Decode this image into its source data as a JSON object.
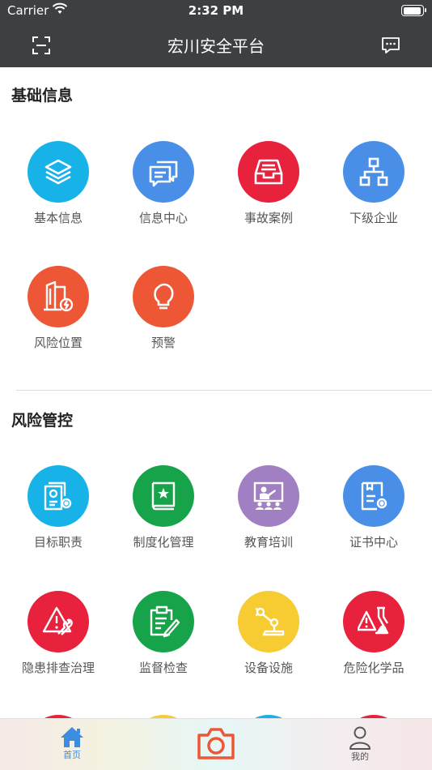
{
  "status_bar": {
    "carrier": "Carrier",
    "time": "2:32 PM"
  },
  "nav": {
    "title": "宏川安全平台"
  },
  "sections": [
    {
      "title": "基础信息",
      "items": [
        {
          "label": "基本信息",
          "icon": "layers-icon",
          "color": "#17b3e8"
        },
        {
          "label": "信息中心",
          "icon": "chat-bubbles-icon",
          "color": "#4a8fe7"
        },
        {
          "label": "事故案例",
          "icon": "inbox-tray-icon",
          "color": "#e8213c"
        },
        {
          "label": "下级企业",
          "icon": "org-chart-icon",
          "color": "#4a8fe7"
        },
        {
          "label": "风险位置",
          "icon": "building-alert-icon",
          "color": "#ee5736"
        },
        {
          "label": "预警",
          "icon": "lightbulb-icon",
          "color": "#ee5736"
        }
      ]
    },
    {
      "title": "风险管控",
      "items": [
        {
          "label": "目标职责",
          "icon": "document-gear-icon",
          "color": "#17b3e8"
        },
        {
          "label": "制度化管理",
          "icon": "book-star-icon",
          "color": "#17a34a"
        },
        {
          "label": "教育培训",
          "icon": "teacher-board-icon",
          "color": "#a07fc3"
        },
        {
          "label": "证书中心",
          "icon": "certificate-gear-icon",
          "color": "#4a8fe7"
        },
        {
          "label": "隐患排查治理",
          "icon": "warning-wrench-icon",
          "color": "#e8213c"
        },
        {
          "label": "监督检查",
          "icon": "clipboard-pen-icon",
          "color": "#17a34a"
        },
        {
          "label": "设备设施",
          "icon": "robot-arm-icon",
          "color": "#f7cc32"
        },
        {
          "label": "危险化学品",
          "icon": "flask-warning-icon",
          "color": "#e8213c"
        }
      ]
    }
  ],
  "partial_row_colors": [
    "#e8213c",
    "#f7cc32",
    "#17b3e8",
    "#e8213c"
  ],
  "tab_bar": {
    "home_label": "首页",
    "mine_label": "我的",
    "home_color": "#3c8de0",
    "camera_color": "#ee5736"
  }
}
